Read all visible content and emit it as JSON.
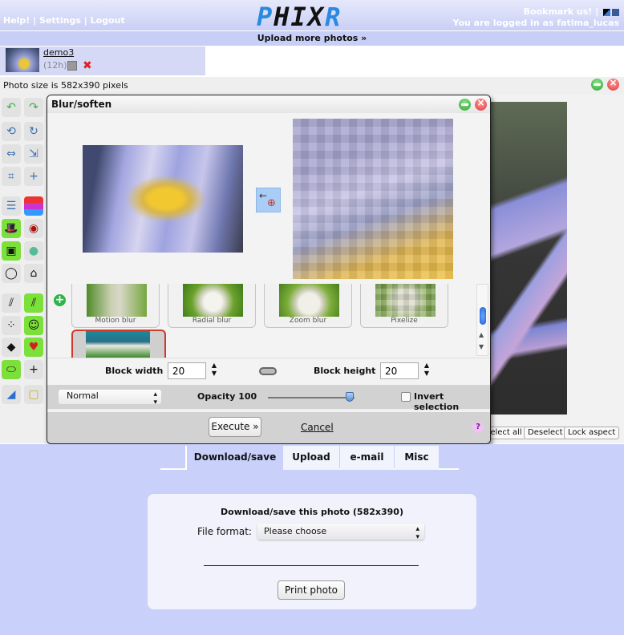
{
  "header": {
    "top_links": [
      "Help!",
      "Settings",
      "Logout"
    ],
    "separator": " | ",
    "logo_text": "PHIXR",
    "bookmark": "Bookmark us!",
    "logged_in": "You are logged in as fatima_lucas",
    "upload_more": "Upload more photos »"
  },
  "photo_list": [
    {
      "name": "demo3",
      "age": "(12h)",
      "icons": [
        "copy-icon",
        "delete-icon"
      ]
    }
  ],
  "editor": {
    "photo_size_text": "Photo size is 582x390 pixels",
    "window_controls": [
      "minimize",
      "close"
    ],
    "selection_buttons": [
      "Select all",
      "Deselect",
      "Lock aspect"
    ],
    "toolbar_icons": [
      "undo-icon",
      "redo-icon",
      "rotate-icon",
      "rotate-step-icon",
      "flip-icon",
      "resize-icon",
      "crop-icon",
      "add-canvas-icon",
      "adjust-icon",
      "color-balance-icon",
      "sepia-icon",
      "red-eye-icon",
      "vignette-icon",
      "shapes-icon",
      "lasso-icon",
      "eraser-icon",
      "lines-icon",
      "stripes-icon",
      "noise-icon",
      "smiley-icon",
      "face-sticker-icon",
      "heart-icon",
      "frame-icon",
      "add-overlay-icon",
      "corner-icon",
      "border-icon"
    ]
  },
  "dialog": {
    "title": "Blur/soften",
    "filters": [
      {
        "label": "Motion blur"
      },
      {
        "label": "Radial blur"
      },
      {
        "label": "Zoom blur"
      },
      {
        "label": "Pixelize"
      }
    ],
    "selected_filter_index": 4,
    "block_width_label": "Block width",
    "block_width": "20",
    "block_height_label": "Block height",
    "block_height": "20",
    "blend_mode": "Normal",
    "opacity_label": "Opacity",
    "opacity": "100",
    "opacity_value": 100,
    "invert_label": "Invert selection",
    "invert_checked": false,
    "execute_label": "Execute »",
    "cancel_label": "Cancel",
    "help_label": "?"
  },
  "bottom": {
    "tabs": [
      "Download/save",
      "Upload",
      "e-mail",
      "Misc"
    ],
    "active_tab": 0,
    "save_title": "Download/save this photo (582x390)",
    "file_format_label": "File format:",
    "file_format_value": "Please choose",
    "print_label": "Print photo"
  }
}
